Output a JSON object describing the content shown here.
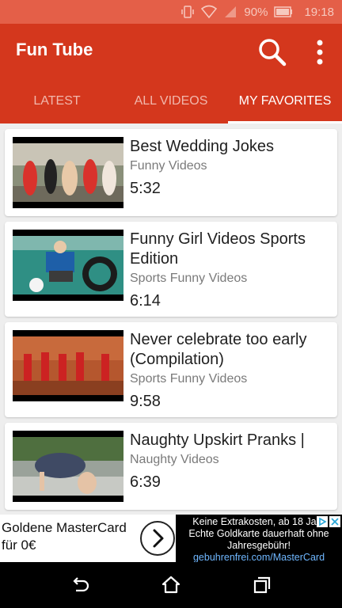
{
  "status": {
    "battery": "90%",
    "time": "19:18"
  },
  "app": {
    "title": "Fun Tube"
  },
  "tabs": [
    {
      "label": "LATEST",
      "active": false
    },
    {
      "label": "ALL VIDEOS",
      "active": false
    },
    {
      "label": "MY FAVORITES",
      "active": true
    }
  ],
  "videos": [
    {
      "title": "Best Wedding Jokes",
      "category": "Funny Videos",
      "duration": "5:32"
    },
    {
      "title": "Funny Girl Videos Sports Edition",
      "category": "Sports Funny Videos",
      "duration": "6:14"
    },
    {
      "title": "Never celebrate too early (Compilation)",
      "category": "Sports Funny Videos",
      "duration": "9:58"
    },
    {
      "title": "Naughty Upskirt Pranks |",
      "category": "Naughty Videos",
      "duration": "6:39"
    }
  ],
  "ad": {
    "left_line1": "Goldene MasterCard",
    "left_line2": "für 0€",
    "right_line1": "Keine Extrakosten, ab 18 Jahr",
    "right_line2": "Echte Goldkarte dauerhaft ohne",
    "right_line3": "Jahresgebühr!",
    "url": "gebuhrenfrei.com/MasterCard"
  },
  "colors": {
    "appbar": "#d4371d",
    "statusbar": "#e45f48",
    "background": "#eeeeee"
  }
}
